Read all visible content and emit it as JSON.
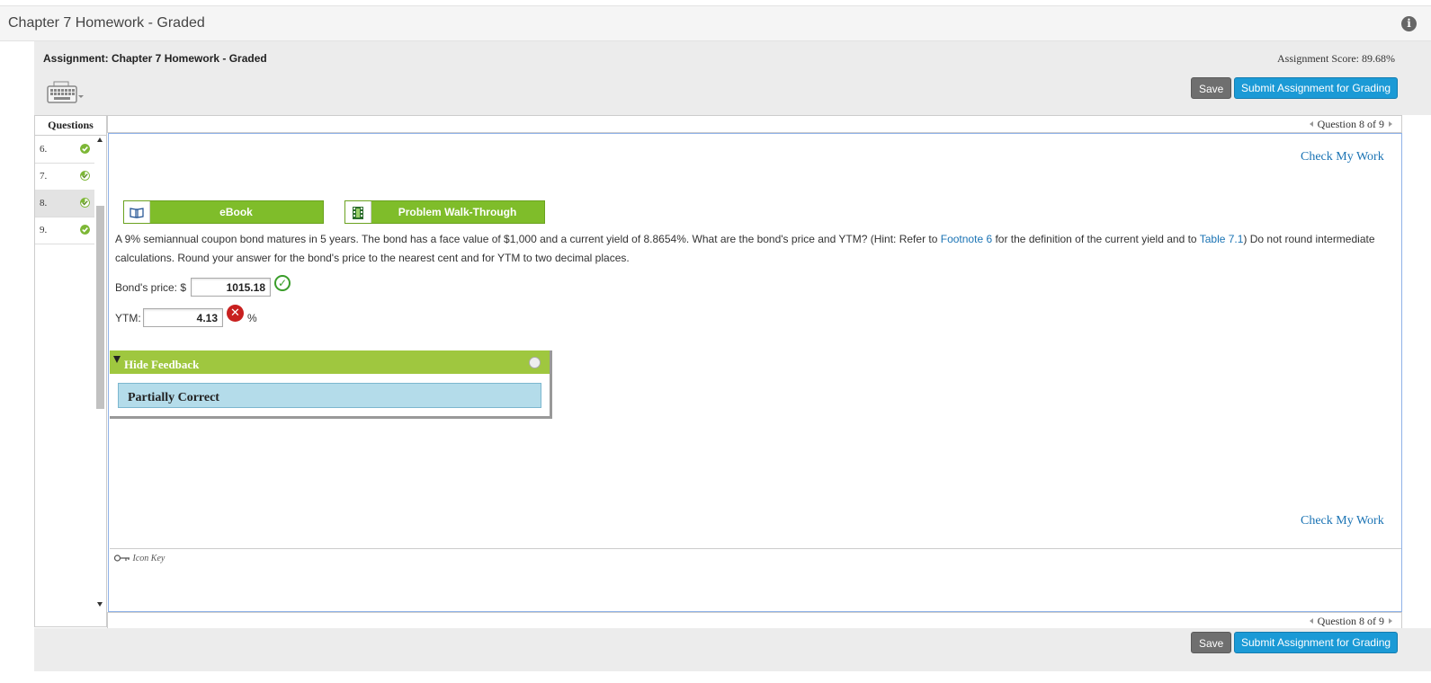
{
  "window": {
    "title": "Chapter 7 Homework - Graded",
    "info_icon": "info-icon"
  },
  "header": {
    "assignment_title": "Assignment: Chapter 7 Homework - Graded",
    "assignment_score": "Assignment Score: 89.68%",
    "keyboard_icon": "keyboard-icon",
    "save_label": "Save",
    "submit_label": "Submit Assignment for Grading"
  },
  "questions_panel": {
    "header": "Questions",
    "items": [
      {
        "number": "6.",
        "status": "correct",
        "active": false
      },
      {
        "number": "7.",
        "status": "partial",
        "active": false
      },
      {
        "number": "8.",
        "status": "partial",
        "active": true
      },
      {
        "number": "9.",
        "status": "correct",
        "active": false
      }
    ]
  },
  "nav": {
    "question_position": "Question 8 of 9"
  },
  "main": {
    "check_my_work": "Check My Work",
    "tools": [
      {
        "label": "eBook",
        "icon": "book-icon"
      },
      {
        "label": "Problem Walk-Through",
        "icon": "film-icon"
      }
    ],
    "question": {
      "text_before_footnote": "A 9% semiannual coupon bond matures in 5 years. The bond has a face value of $1,000 and a current yield of 8.8654%. What are the bond's price and YTM? (Hint: Refer to ",
      "footnote_link": "Footnote 6",
      "text_mid": " for the definition of the current yield and to ",
      "table_link": "Table 7.1",
      "text_after": ") Do not round intermediate calculations. Round your answer for the bond's price to the nearest cent and for YTM to two decimal places."
    },
    "answers": [
      {
        "label": "Bond's price: $",
        "value": "1015.18",
        "result": "correct",
        "unit": ""
      },
      {
        "label": "YTM:",
        "value": "4.13",
        "result": "incorrect",
        "unit": "%"
      }
    ],
    "feedback": {
      "toggle_label": "Hide Feedback",
      "result_text": "Partially Correct"
    },
    "icon_key": "Icon Key"
  },
  "colors": {
    "accent_blue": "#1b9ad6",
    "tool_green": "#7fbd2a",
    "feedback_green": "#9fc73f",
    "correct_green": "#3a9d2a",
    "incorrect_red": "#c8201f"
  }
}
